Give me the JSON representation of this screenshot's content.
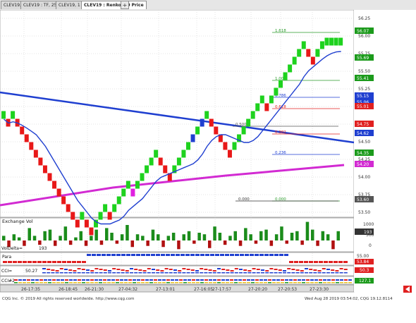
{
  "tabs": [
    {
      "label": "CLEV19, 60"
    },
    {
      "label": "CLEV19 : TF, 25 Boxes"
    },
    {
      "label": "CLEV19, 1 : HA"
    },
    {
      "label": "CLEV19 : Renko, 10 Price"
    }
  ],
  "active_tab": 3,
  "price_axis": [
    "56.25",
    "56.00",
    "55.75",
    "55.50",
    "55.25",
    "55.00",
    "54.75",
    "54.50",
    "54.25",
    "54.00",
    "53.75",
    "53.50"
  ],
  "price_badges": [
    {
      "text": "56.07",
      "color": "#1b9a1b"
    },
    {
      "text": "55.69",
      "color": "#1b9a1b"
    },
    {
      "text": "55.41",
      "color": "#1b9a1b"
    },
    {
      "text": "55.15",
      "color": "#1f3fd0"
    },
    {
      "text": "55.06",
      "color": "#1f3fd0"
    },
    {
      "text": "55.01",
      "color": "#e02020"
    },
    {
      "text": "54.75",
      "color": "#e02020"
    },
    {
      "text": "54.62",
      "color": "#1f3fd0"
    },
    {
      "text": "54.35",
      "color": "#1b9a1b"
    },
    {
      "text": "54.20",
      "color": "#d22ad2"
    },
    {
      "text": "53.60",
      "color": "#555555"
    }
  ],
  "fib_labels": [
    {
      "text": "1.618",
      "color": "#2a9a2a"
    },
    {
      "text": "1.000",
      "color": "#2a9a2a"
    },
    {
      "text": "0.786",
      "color": "#1f3fd0"
    },
    {
      "text": "0.618",
      "color": "#e02020"
    },
    {
      "text": "0.500",
      "color": "#555555"
    },
    {
      "text": "0.382",
      "color": "#e02020"
    },
    {
      "text": "0.236",
      "color": "#1f3fd0"
    },
    {
      "text": "0.000",
      "color": "#2a9a2a"
    },
    {
      "text": "0.000",
      "color": "#333333"
    }
  ],
  "panels": {
    "exchange_vol": {
      "label": "Exchange Vol",
      "axis": [
        "1000",
        "500",
        "0"
      ],
      "last": "193"
    },
    "vol_delta": {
      "label": "VolDelta=",
      "value": "193"
    },
    "para": {
      "label": "Para",
      "axis": [
        "55.00",
        "54.00"
      ],
      "last": "53.84"
    },
    "cci1": {
      "label": "CCI=",
      "value": "50.27",
      "last": "50.3"
    },
    "cci2": {
      "label": "CCI#2",
      "last": "127.1"
    }
  },
  "time_labels": [
    "26-17:35",
    "26-18:45",
    "26-21:30",
    "27-04:32",
    "27-13:01",
    "27-16:05",
    "27-17:57",
    "27-20:20",
    "27-20:53",
    "27-23:30"
  ],
  "renko_bricks": [
    "g",
    "r",
    "g",
    "r",
    "r",
    "r",
    "r",
    "r",
    "r",
    "r",
    "r",
    "r",
    "r",
    "r",
    "r",
    "r",
    "r",
    "g",
    "r",
    "r",
    "g",
    "g",
    "g",
    "r",
    "g",
    "g",
    "g",
    "g",
    "m",
    "g",
    "g",
    "g",
    "g",
    "g",
    "r",
    "r",
    "r",
    "g",
    "g",
    "g",
    "g",
    "b",
    "g",
    "b",
    "g",
    "r",
    "r",
    "r",
    "r",
    "r",
    "g",
    "g",
    "g",
    "g",
    "g",
    "g",
    "g",
    "r",
    "g",
    "g",
    "g",
    "g",
    "g",
    "g",
    "g",
    "g",
    "r",
    "r",
    "g",
    "g",
    "g",
    "g",
    "g",
    "g"
  ],
  "colors": {
    "up": "#1ed21e",
    "down": "#e81818",
    "magenta": "#e020e0",
    "blue": "#1f3fd0",
    "trend": "#1f3fd0",
    "ma": "#1f3fd0",
    "lower": "#d22ad2"
  },
  "footer": {
    "left": "CQG Inc. © 2019 All rights reserved worldwide. http://www.cqg.com",
    "right": "Wed Aug 28 2019 03:54:02, CQG 19.12.8114"
  }
}
